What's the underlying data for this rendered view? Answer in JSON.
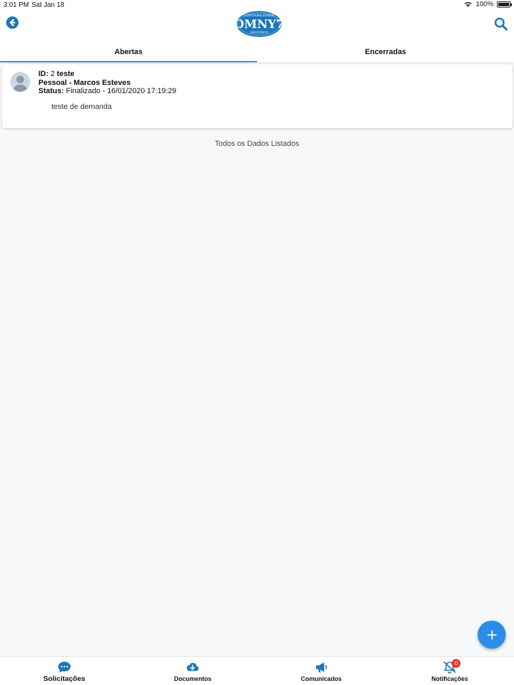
{
  "status_bar": {
    "time": "3:01 PM",
    "date": "Sat Jan 18",
    "battery": "100%",
    "icons": [
      "wifi-icon",
      "battery-icon"
    ]
  },
  "header": {
    "logo": {
      "top_text": "CONTABILIDADE",
      "main_text": "OMNY7",
      "bottom_text": "SEGUROS"
    },
    "back_icon": "arrow-left-circle-icon",
    "search_icon": "search-icon"
  },
  "tabs": [
    {
      "label": "Abertas",
      "active": true
    },
    {
      "label": "Encerradas",
      "active": false
    }
  ],
  "items": [
    {
      "id_label": "ID:",
      "id_value": "2",
      "title": "teste",
      "type_line": "Pessoal - Marcos Esteves",
      "status_label": "Status:",
      "status_value": "Finalizado - 16/01/2020 17:19:29",
      "description": "teste de demanda"
    }
  ],
  "list_footer": "Todos os Dados Listados",
  "fab_icon": "plus-icon",
  "bottom_nav": [
    {
      "label": "Solicitações",
      "icon": "chat-icon",
      "active": true
    },
    {
      "label": "Documentos",
      "icon": "cloud-download-icon",
      "active": false
    },
    {
      "label": "Comunicados",
      "icon": "megaphone-icon",
      "active": false
    },
    {
      "label": "Notificações",
      "icon": "bell-off-icon",
      "active": false,
      "badge": "0"
    }
  ],
  "colors": {
    "accent": "#1b76b8",
    "tab_indicator": "#3d8fc9",
    "fab": "#2a8ee8",
    "badge": "#e53935",
    "background": "#f7f8fa"
  }
}
